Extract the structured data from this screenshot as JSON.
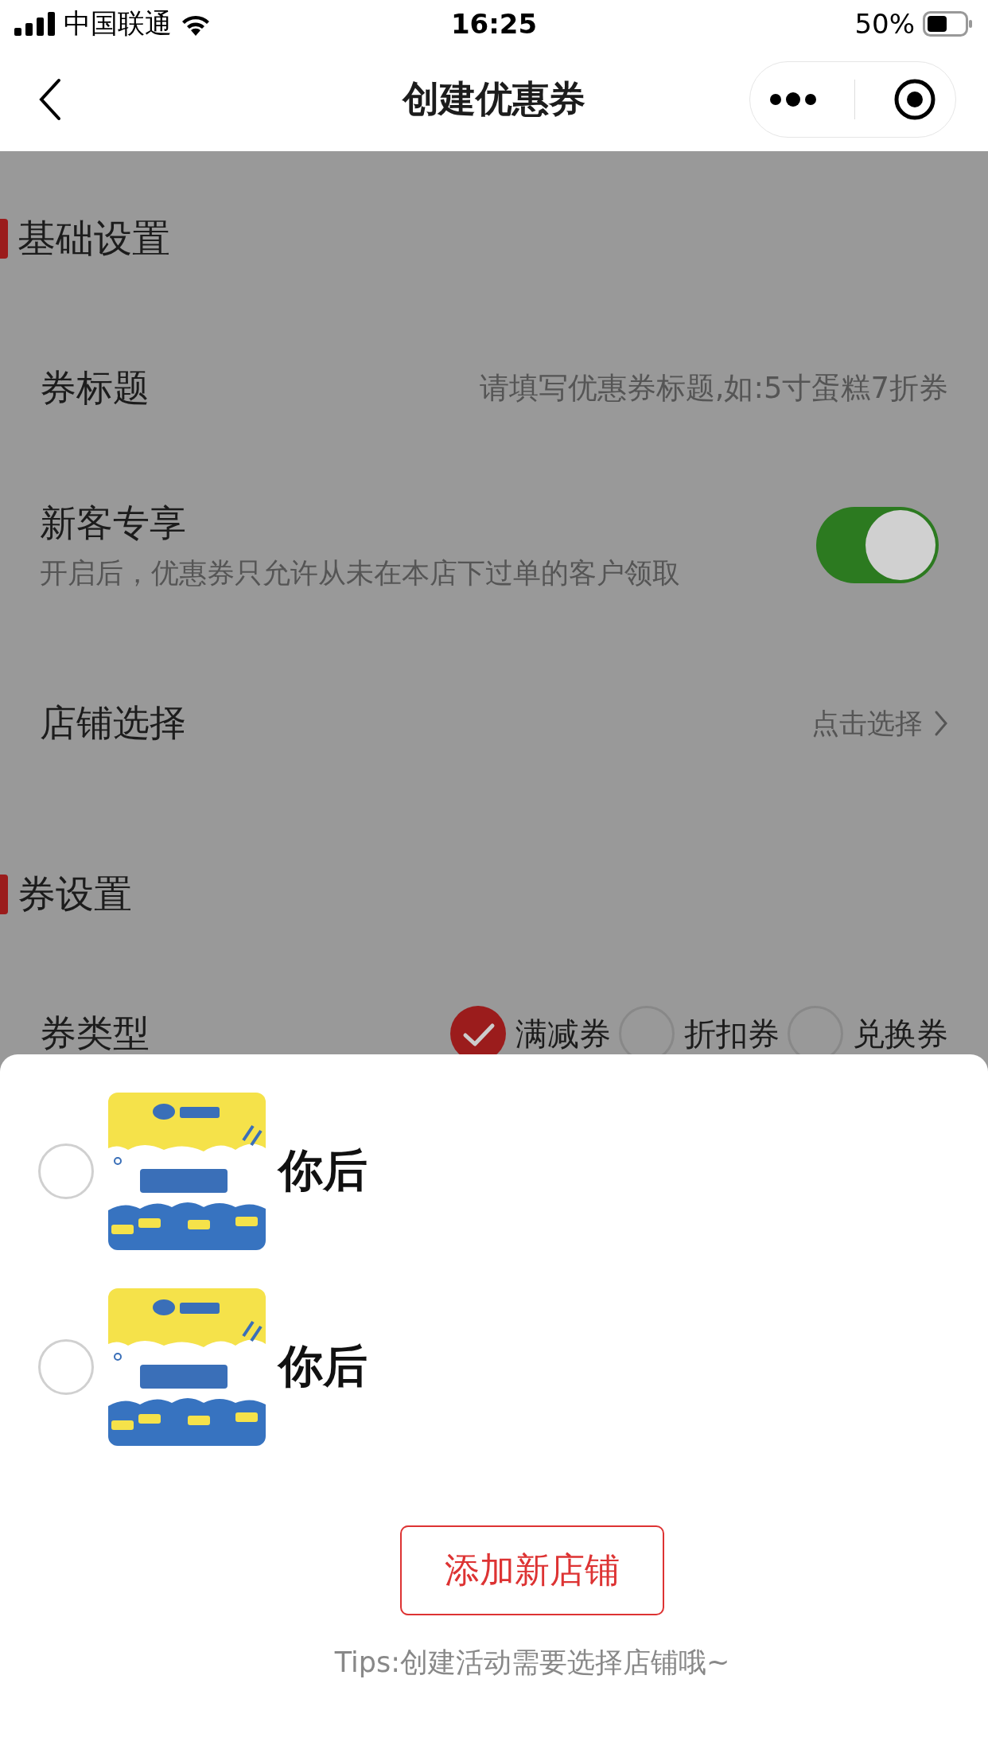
{
  "status_bar": {
    "carrier": "中国联通",
    "time": "16:25",
    "battery": "50%"
  },
  "nav": {
    "title": "创建优惠券"
  },
  "sections": [
    {
      "title": "基础设置",
      "rows": [
        {
          "kind": "input",
          "label": "券标题",
          "placeholder": "请填写优惠券标题,如:5寸蛋糕7折券"
        },
        {
          "kind": "toggle",
          "label": "新客专享",
          "description": "开启后，优惠券只允许从未在本店下过单的客户领取",
          "on": true
        },
        {
          "kind": "link",
          "label": "店铺选择",
          "value": "点击选择"
        }
      ]
    },
    {
      "title": "券设置",
      "rows": [
        {
          "kind": "radio",
          "label": "券类型",
          "options": [
            {
              "label": "满减券",
              "selected": true
            },
            {
              "label": "折扣券",
              "selected": false
            },
            {
              "label": "兑换券",
              "selected": false
            }
          ]
        }
      ]
    }
  ],
  "sheet": {
    "stores": [
      {
        "name": "你后",
        "selected": false
      },
      {
        "name": "你后",
        "selected": false
      }
    ],
    "button": "添加新店铺",
    "tips": "Tips:创建活动需要选择店铺哦~"
  }
}
